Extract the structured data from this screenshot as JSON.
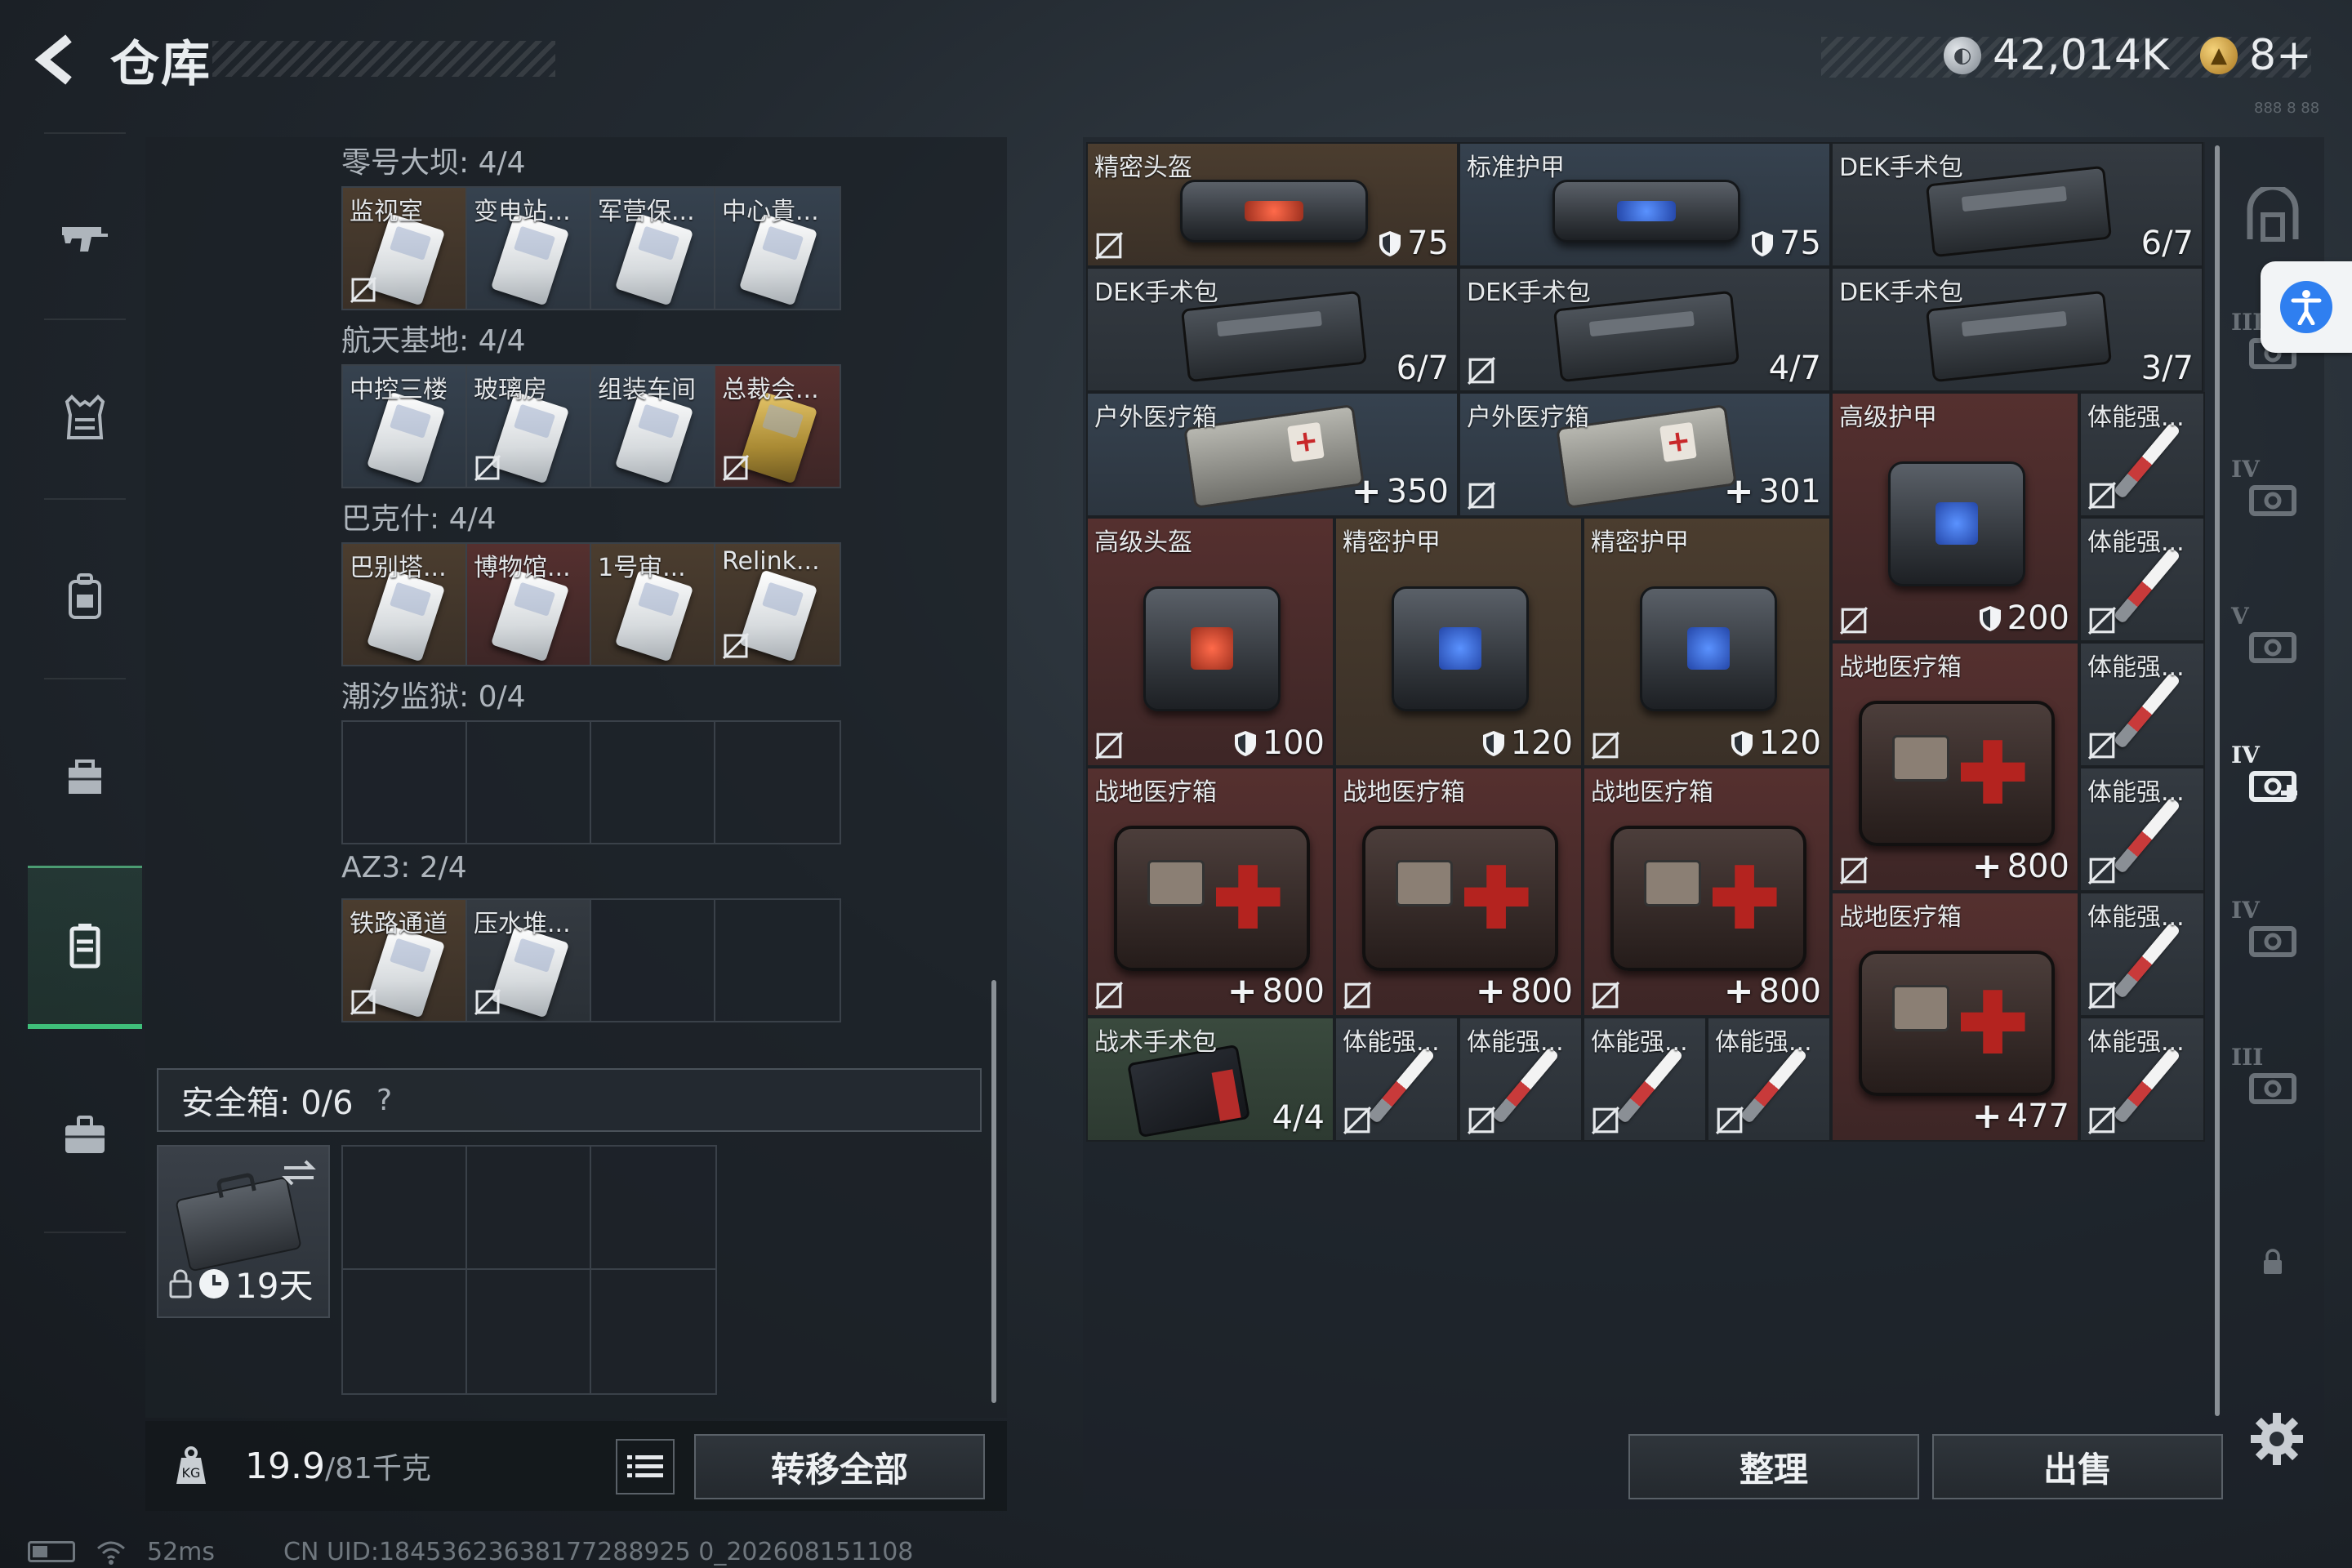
{
  "header": {
    "title": "仓库",
    "currencies": [
      {
        "icon": "silver-coin-icon",
        "value": "42,014K"
      },
      {
        "icon": "gold-coin-icon",
        "value": "8+"
      }
    ],
    "corner_text": "888 8 88"
  },
  "left_nav": [
    {
      "icon": "gun-icon",
      "active": false
    },
    {
      "icon": "armor-vest-icon",
      "active": false
    },
    {
      "icon": "backpack-icon",
      "active": false
    },
    {
      "icon": "chest-rig-icon",
      "active": false
    },
    {
      "icon": "keycard-case-icon",
      "active": true
    },
    {
      "icon": "briefcase-icon",
      "active": false
    }
  ],
  "keycard_sections": [
    {
      "label": "零号大坝: 4/4",
      "cards": [
        {
          "name": "监视室",
          "color": "white",
          "bg": "brown",
          "no_sale": true
        },
        {
          "name": "变电站...",
          "color": "white",
          "bg": "blue",
          "no_sale": false
        },
        {
          "name": "军营保...",
          "color": "white",
          "bg": "blue",
          "no_sale": false
        },
        {
          "name": "中心貴...",
          "color": "white",
          "bg": "blue",
          "no_sale": false
        }
      ]
    },
    {
      "label": "航天基地: 4/4",
      "cards": [
        {
          "name": "中控三楼",
          "color": "white",
          "bg": "blue",
          "no_sale": false
        },
        {
          "name": "玻璃房",
          "color": "white",
          "bg": "blue",
          "no_sale": true
        },
        {
          "name": "组装车间",
          "color": "white",
          "bg": "blue",
          "no_sale": false
        },
        {
          "name": "总裁会...",
          "color": "gold",
          "bg": "red",
          "no_sale": true
        }
      ]
    },
    {
      "label": "巴克什: 4/4",
      "cards": [
        {
          "name": "巴别塔...",
          "color": "white",
          "bg": "brown",
          "no_sale": false
        },
        {
          "name": "博物馆...",
          "color": "white",
          "bg": "red",
          "no_sale": false
        },
        {
          "name": "1号审...",
          "color": "white",
          "bg": "brown",
          "no_sale": false
        },
        {
          "name": "Relink...",
          "color": "white",
          "bg": "brown",
          "no_sale": true
        }
      ]
    },
    {
      "label": "潮汐监狱: 0/4",
      "cards": []
    },
    {
      "label": "AZ3: 2/4",
      "cards": [
        {
          "name": "铁路通道",
          "color": "white",
          "bg": "brown",
          "no_sale": true
        },
        {
          "name": "压水堆...",
          "color": "white",
          "bg": "gray",
          "no_sale": true
        }
      ]
    }
  ],
  "safebox": {
    "label": "安全箱: 0/6",
    "help": "?",
    "expiry": "19天"
  },
  "bottom_left": {
    "weight_value": "19.9",
    "weight_max": "/81千克",
    "transfer_label": "转移全部"
  },
  "inventory": [
    {
      "name": "精密头盔",
      "value": "75",
      "stat": "shield",
      "no_sale": true,
      "bg": "brown",
      "art": "bag-red"
    },
    {
      "name": "标准护甲",
      "value": "75",
      "stat": "shield",
      "no_sale": false,
      "bg": "blue",
      "art": "bag-blue"
    },
    {
      "name": "DEK手术包",
      "value": "6/7",
      "stat": "count",
      "no_sale": false,
      "bg": "gray",
      "art": "pouch"
    },
    {
      "name": "DEK手术包",
      "value": "6/7",
      "stat": "count",
      "no_sale": false,
      "bg": "gray",
      "art": "pouch"
    },
    {
      "name": "DEK手术包",
      "value": "4/7",
      "stat": "count",
      "no_sale": true,
      "bg": "gray",
      "art": "pouch"
    },
    {
      "name": "DEK手术包",
      "value": "3/7",
      "stat": "count",
      "no_sale": false,
      "bg": "gray",
      "art": "pouch"
    },
    {
      "name": "户外医疗箱",
      "value": "350",
      "stat": "heal",
      "no_sale": false,
      "bg": "blue",
      "art": "outdoor"
    },
    {
      "name": "户外医疗箱",
      "value": "301",
      "stat": "heal",
      "no_sale": true,
      "bg": "blue",
      "art": "outdoor"
    },
    {
      "name": "高级护甲",
      "value": "200",
      "stat": "shield",
      "no_sale": true,
      "bg": "red",
      "art": "bag-blue"
    },
    {
      "name": "高级头盔",
      "value": "100",
      "stat": "shield",
      "no_sale": true,
      "bg": "red",
      "art": "bag-red"
    },
    {
      "name": "精密护甲",
      "value": "120",
      "stat": "shield",
      "no_sale": false,
      "bg": "brown",
      "art": "bag-blue"
    },
    {
      "name": "精密护甲",
      "value": "120",
      "stat": "shield",
      "no_sale": true,
      "bg": "brown",
      "art": "bag-blue"
    },
    {
      "name": "战地医疗箱",
      "value": "800",
      "stat": "heal",
      "no_sale": true,
      "bg": "red",
      "art": "medbox"
    },
    {
      "name": "战地医疗箱",
      "value": "800",
      "stat": "heal",
      "no_sale": true,
      "bg": "red",
      "art": "medbox"
    },
    {
      "name": "战地医疗箱",
      "value": "800",
      "stat": "heal",
      "no_sale": true,
      "bg": "red",
      "art": "medbox"
    },
    {
      "name": "战地医疗箱",
      "value": "800",
      "stat": "heal",
      "no_sale": true,
      "bg": "red",
      "art": "medbox"
    },
    {
      "name": "战地医疗箱",
      "value": "477",
      "stat": "heal",
      "no_sale": false,
      "bg": "red",
      "art": "medbox"
    },
    {
      "name": "战术手术包",
      "value": "4/4",
      "stat": "count",
      "no_sale": false,
      "bg": "green",
      "art": "tactical"
    },
    {
      "name": "体能强...",
      "value": "",
      "stat": "none",
      "no_sale": true,
      "bg": "gray",
      "art": "syringe"
    },
    {
      "name": "体能强...",
      "value": "",
      "stat": "none",
      "no_sale": true,
      "bg": "gray",
      "art": "syringe"
    },
    {
      "name": "体能强...",
      "value": "",
      "stat": "none",
      "no_sale": true,
      "bg": "gray",
      "art": "syringe"
    },
    {
      "name": "体能强...",
      "value": "",
      "stat": "none",
      "no_sale": true,
      "bg": "gray",
      "art": "syringe"
    },
    {
      "name": "体能强...",
      "value": "",
      "stat": "none",
      "no_sale": true,
      "bg": "gray",
      "art": "syringe"
    },
    {
      "name": "体能强...",
      "value": "",
      "stat": "none",
      "no_sale": true,
      "bg": "gray",
      "art": "syringe"
    },
    {
      "name": "体能强...",
      "value": "",
      "stat": "none",
      "no_sale": true,
      "bg": "gray",
      "art": "syringe"
    },
    {
      "name": "体能强...",
      "value": "",
      "stat": "none",
      "no_sale": true,
      "bg": "gray",
      "art": "syringe"
    },
    {
      "name": "体能强...",
      "value": "",
      "stat": "none",
      "no_sale": true,
      "bg": "gray",
      "art": "syringe"
    },
    {
      "name": "体能强...",
      "value": "",
      "stat": "none",
      "no_sale": true,
      "bg": "gray",
      "art": "syringe"
    }
  ],
  "right_sidebar": [
    {
      "icon": "storage-home-icon",
      "label": ""
    },
    {
      "icon": "tier-3-storage-icon",
      "label": "III"
    },
    {
      "icon": "tier-4-storage-icon",
      "label": "IV"
    },
    {
      "icon": "tier-5-storage-icon",
      "label": "V"
    },
    {
      "icon": "tier-4-add-storage-icon",
      "label": "IV"
    },
    {
      "icon": "tier-4-storage-icon",
      "label": "IV"
    },
    {
      "icon": "tier-3-storage-icon",
      "label": "III"
    },
    {
      "icon": "lock-icon",
      "label": ""
    }
  ],
  "actions": {
    "organize": "整理",
    "sell": "出售"
  },
  "status": {
    "ping": "52ms",
    "uid": "CN UID:18453623638177288925 0_202608151108"
  }
}
